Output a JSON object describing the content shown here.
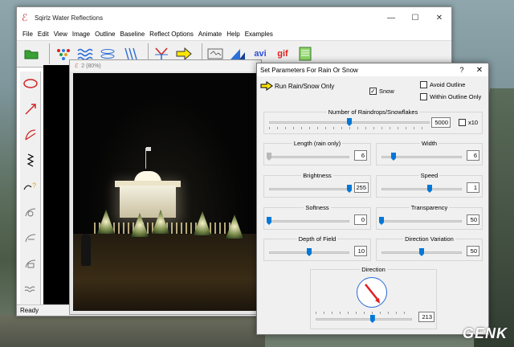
{
  "app": {
    "title": "Sqirlz Water Reflections",
    "status": "Ready",
    "menu": [
      "File",
      "Edit",
      "View",
      "Image",
      "Outline",
      "Baseline",
      "Reflect Options",
      "Animate",
      "Help",
      "Examples"
    ],
    "toolbar_text": {
      "avi": "avi",
      "gif": "gif"
    },
    "window_buttons": {
      "minimize": "—",
      "maximize": "☐",
      "close": "✕"
    }
  },
  "child_window": {
    "title": "2  (80%)"
  },
  "dialog": {
    "title": "Set Parameters For Rain Or Snow",
    "help": "?",
    "close": "✕",
    "run_button": "Run Rain/Snow Only",
    "snow_label": "Snow",
    "snow_checked": true,
    "avoid_outline_label": "Avoid Outline",
    "within_outline_label": "Within Outline Only",
    "x10_label": "x10",
    "sliders": {
      "raindrops": {
        "label": "Number of Raindrops/Snowflakes",
        "value": "5000",
        "level": 0.5
      },
      "length": {
        "label": "Length (rain only)",
        "value": "6",
        "level": 0.0
      },
      "width": {
        "label": "Width",
        "value": "6",
        "level": 0.15
      },
      "brightness": {
        "label": "Brightness",
        "value": "255",
        "level": 1.0
      },
      "speed": {
        "label": "Speed",
        "value": "1",
        "level": 0.6
      },
      "softness": {
        "label": "Softness",
        "value": "0",
        "level": 0.0
      },
      "transparency": {
        "label": "Transparency",
        "value": "50",
        "level": 0.0
      },
      "depth": {
        "label": "Depth of Field",
        "value": "10",
        "level": 0.5
      },
      "variation": {
        "label": "Direction Variation",
        "value": "50",
        "level": 0.5
      },
      "direction": {
        "label": "Direction",
        "value": "213",
        "level": 0.59
      }
    }
  },
  "watermark": "GENK",
  "colors": {
    "accent": "#0078d7",
    "dial_needle": "#e02020"
  }
}
